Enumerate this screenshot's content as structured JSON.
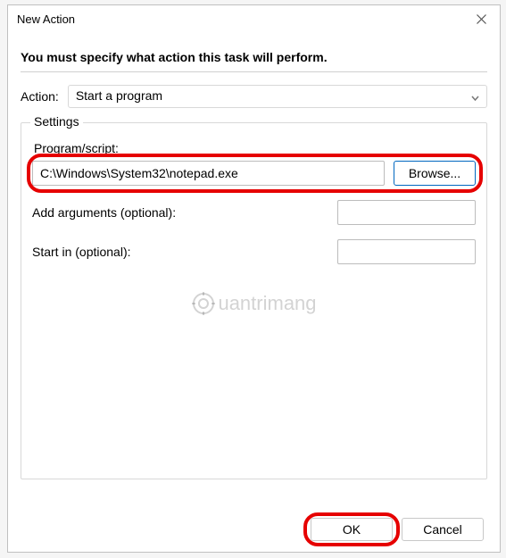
{
  "titlebar": {
    "title": "New Action"
  },
  "instruction": "You must specify what action this task will perform.",
  "action": {
    "label": "Action:",
    "selected": "Start a program"
  },
  "settings": {
    "legend": "Settings",
    "program_script_label": "Program/script:",
    "program_script_value": "C:\\Windows\\System32\\notepad.exe",
    "browse_label": "Browse...",
    "add_arguments_label": "Add arguments (optional):",
    "add_arguments_value": "",
    "start_in_label": "Start in (optional):",
    "start_in_value": ""
  },
  "buttons": {
    "ok": "OK",
    "cancel": "Cancel"
  },
  "watermark": "uantrimang"
}
